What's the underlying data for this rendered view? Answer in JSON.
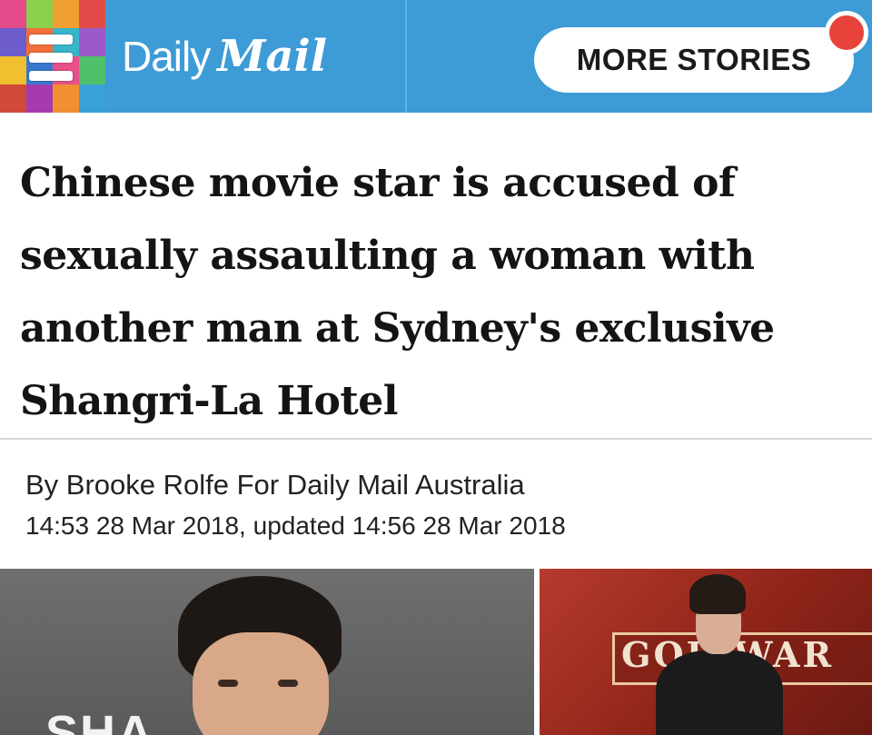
{
  "header": {
    "logo_daily": "Daily",
    "logo_mail": "Mail",
    "more_stories_label": "MORE STORIES",
    "background_color": "#3d9bd6",
    "notification_color": "#e8433a",
    "menu_icon": "hamburger-menu-icon"
  },
  "article": {
    "headline": "Chinese movie star is accused of sexually assaulting a woman with another man at Sydney's exclusive Shangri-La Hotel",
    "byline": "By Brooke Rolfe For Daily Mail Australia",
    "timestamp": "14:53 28 Mar 2018, updated 14:56 28 Mar 2018"
  },
  "photos": {
    "left_backdrop_text": "SHA",
    "right_banner_text": "GOD    WAR"
  }
}
